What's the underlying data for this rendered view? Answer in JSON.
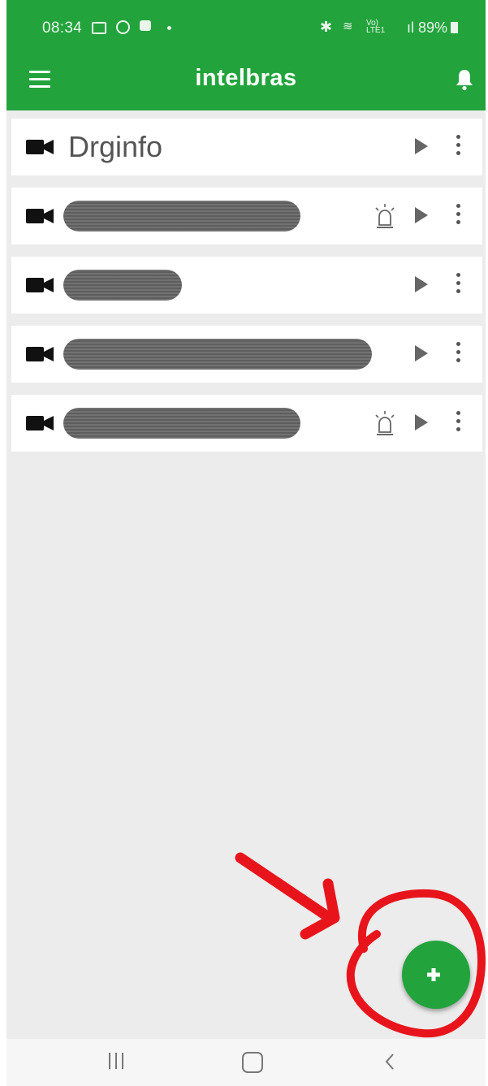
{
  "status_bar": {
    "time": "08:34",
    "battery": "89%"
  },
  "app_bar": {
    "title": "intelbras",
    "color": "#22a33c"
  },
  "devices": [
    {
      "name": "Drginfo",
      "name_redacted": false,
      "alarm": false
    },
    {
      "name_redacted": true,
      "alarm": true
    },
    {
      "name_redacted": true,
      "alarm": false
    },
    {
      "name_redacted": true,
      "alarm": false
    },
    {
      "name_redacted": true,
      "alarm": true
    }
  ],
  "fab": {
    "label": "+"
  },
  "icons": {
    "menu": "menu-icon",
    "notifications": "bell-icon",
    "device": "camera-icon",
    "alarm": "siren-icon",
    "play": "play-icon",
    "more": "kebab-icon",
    "add": "plus-icon"
  },
  "annotation_color": "#e8141c"
}
